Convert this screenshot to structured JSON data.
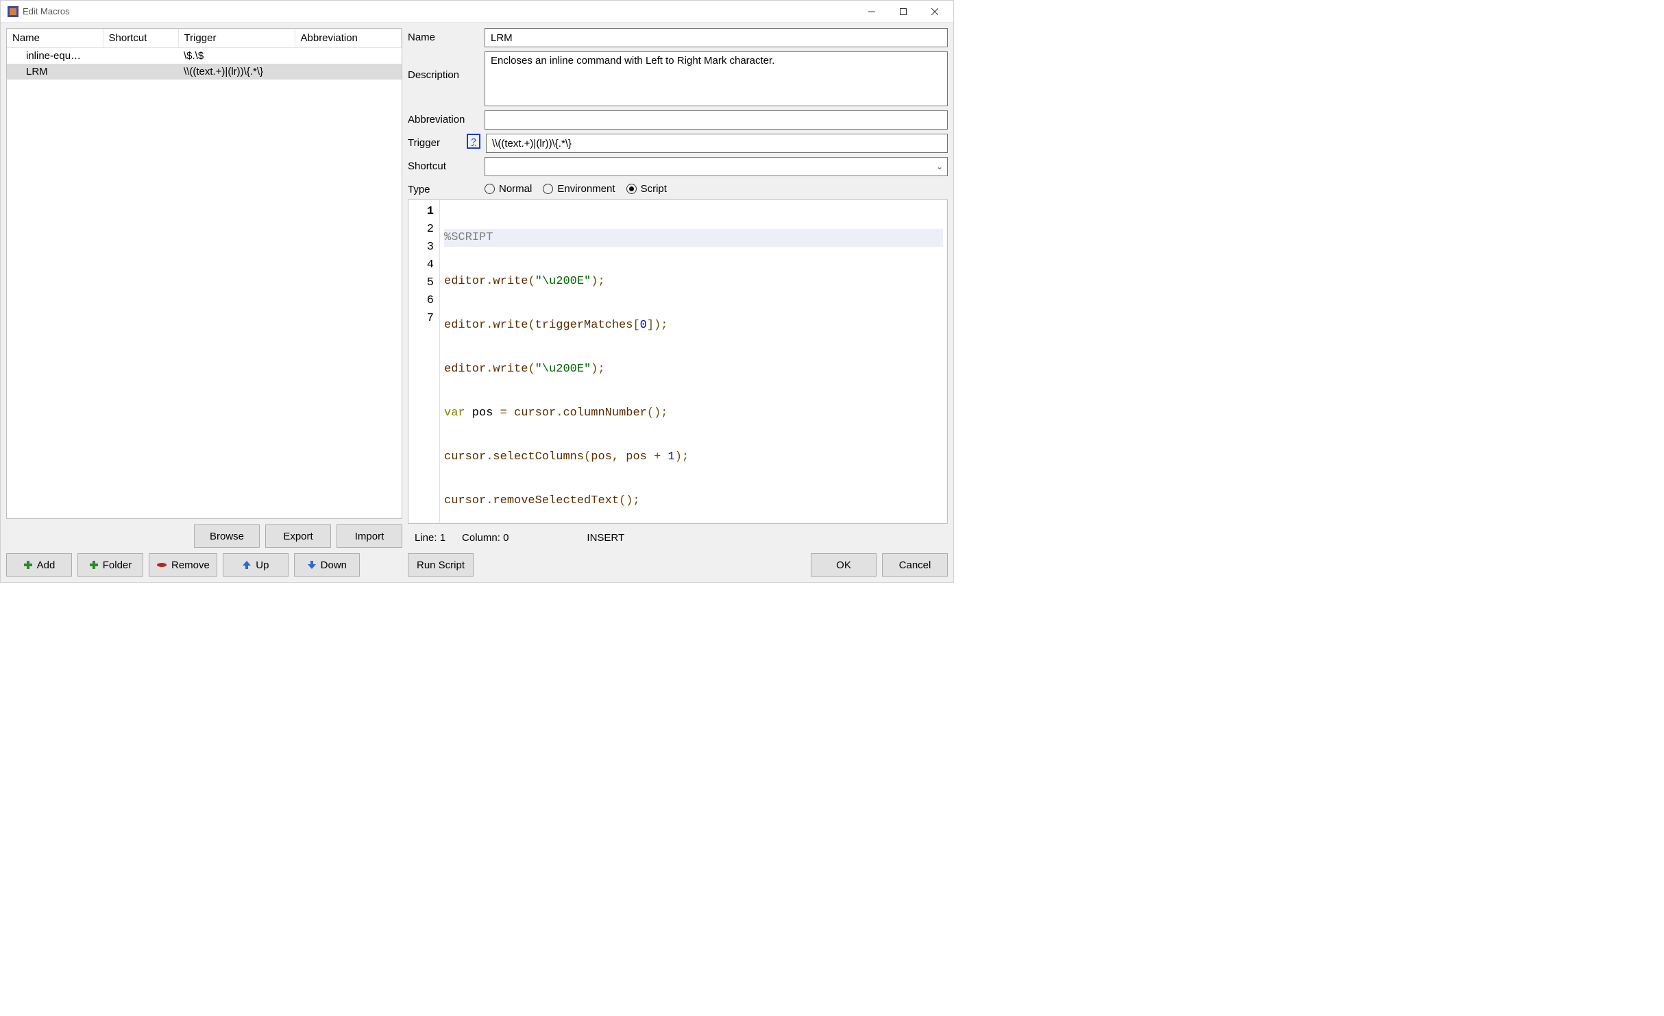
{
  "window": {
    "title": "Edit Macros"
  },
  "table": {
    "headers": {
      "name": "Name",
      "shortcut": "Shortcut",
      "trigger": "Trigger",
      "abbreviation": "Abbreviation"
    },
    "rows": [
      {
        "name": "inline-equ…",
        "shortcut": "",
        "trigger": "\\$.\\$",
        "abbreviation": "",
        "selected": false
      },
      {
        "name": "LRM",
        "shortcut": "",
        "trigger": "\\\\((text.+)|(lr))\\{.*\\}",
        "abbreviation": "",
        "selected": true
      }
    ]
  },
  "midButtons": {
    "browse": "Browse",
    "export": "Export",
    "import": "Import"
  },
  "botButtons": {
    "add": "Add",
    "folder": "Folder",
    "remove": "Remove",
    "up": "Up",
    "down": "Down"
  },
  "form": {
    "labels": {
      "name": "Name",
      "description": "Description",
      "abbreviation": "Abbreviation",
      "trigger": "Trigger",
      "shortcut": "Shortcut",
      "type": "Type",
      "helpMark": "?"
    },
    "name": "LRM",
    "description": "Encloses an inline command with Left to Right Mark character.",
    "abbreviation": "",
    "trigger": "\\\\((text.+)|(lr))\\{.*\\}",
    "shortcut": "",
    "type": {
      "normal": "Normal",
      "environment": "Environment",
      "script": "Script",
      "selected": "script"
    }
  },
  "editor": {
    "lineNumbers": [
      "1",
      "2",
      "3",
      "4",
      "5",
      "6",
      "7"
    ],
    "status": {
      "line": "Line: 1",
      "column": "Column: 0",
      "mode": "INSERT"
    },
    "code": {
      "l1": "%SCRIPT",
      "l2a": "editor",
      "l2b": ".",
      "l2c": "write",
      "l2d": "(",
      "l2e": "\"\\u200E\"",
      "l2f": ");",
      "l3a": "editor",
      "l3b": ".",
      "l3c": "write",
      "l3d": "(",
      "l3e": "triggerMatches",
      "l3f": "[",
      "l3g": "0",
      "l3h": "]);",
      "l4a": "editor",
      "l4b": ".",
      "l4c": "write",
      "l4d": "(",
      "l4e": "\"\\u200E\"",
      "l4f": ");",
      "l5a": "var",
      "l5b": " pos ",
      "l5c": "=",
      "l5d": " cursor",
      "l5e": ".",
      "l5f": "columnNumber",
      "l5g": "();",
      "l6a": "cursor",
      "l6b": ".",
      "l6c": "selectColumns",
      "l6d": "(",
      "l6e": "pos",
      "l6f": ", ",
      "l6g": "pos ",
      "l6h": "+",
      "l6i": " ",
      "l6j": "1",
      "l6k": ");",
      "l7a": "cursor",
      "l7b": ".",
      "l7c": "removeSelectedText",
      "l7d": "();"
    }
  },
  "bottom": {
    "runScript": "Run Script",
    "ok": "OK",
    "cancel": "Cancel"
  }
}
